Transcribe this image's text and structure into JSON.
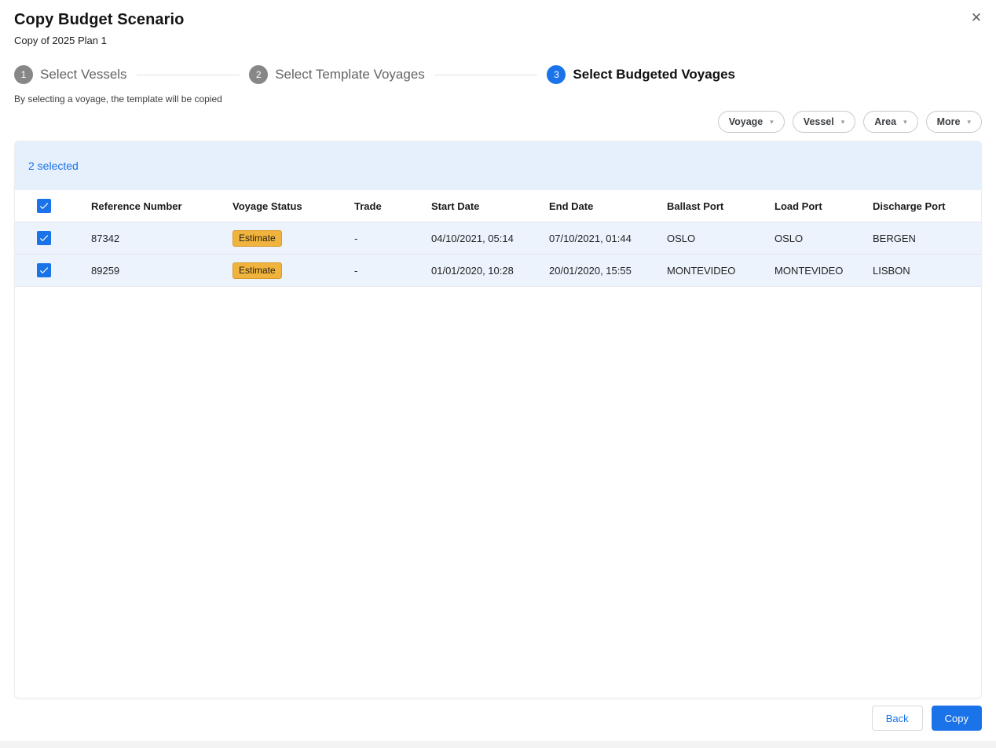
{
  "dialog": {
    "title": "Copy Budget Scenario",
    "subtitle": "Copy of 2025 Plan 1"
  },
  "icons": {
    "close": "✕",
    "chevron_down": "▾"
  },
  "stepper": {
    "steps": [
      {
        "number": "1",
        "label": "Select Vessels",
        "active": false
      },
      {
        "number": "2",
        "label": "Select Template Voyages",
        "active": false
      },
      {
        "number": "3",
        "label": "Select Budgeted Voyages",
        "active": true
      }
    ],
    "helper_text": "By selecting a voyage, the template will be copied"
  },
  "filters": [
    {
      "label": "Voyage"
    },
    {
      "label": "Vessel"
    },
    {
      "label": "Area"
    },
    {
      "label": "More"
    }
  ],
  "table": {
    "selection_text": "2 selected",
    "columns": [
      "Reference Number",
      "Voyage Status",
      "Trade",
      "Start Date",
      "End Date",
      "Ballast Port",
      "Load Port",
      "Discharge Port"
    ],
    "rows": [
      {
        "selected": true,
        "reference_number": "87342",
        "voyage_status": "Estimate",
        "trade": "-",
        "start_date": "04/10/2021, 05:14",
        "end_date": "07/10/2021, 01:44",
        "ballast_port": "OSLO",
        "load_port": "OSLO",
        "discharge_port": "BERGEN"
      },
      {
        "selected": true,
        "reference_number": "89259",
        "voyage_status": "Estimate",
        "trade": "-",
        "start_date": "01/01/2020, 10:28",
        "end_date": "20/01/2020, 15:55",
        "ballast_port": "MONTEVIDEO",
        "load_port": "MONTEVIDEO",
        "discharge_port": "LISBON"
      }
    ]
  },
  "footer": {
    "back_label": "Back",
    "copy_label": "Copy"
  },
  "colors": {
    "accent": "#1a73e8",
    "badge_bg": "#f0b43e",
    "badge_border": "#d79a2b",
    "row_bg": "#ecf3fd",
    "band_bg": "#e6effc"
  }
}
